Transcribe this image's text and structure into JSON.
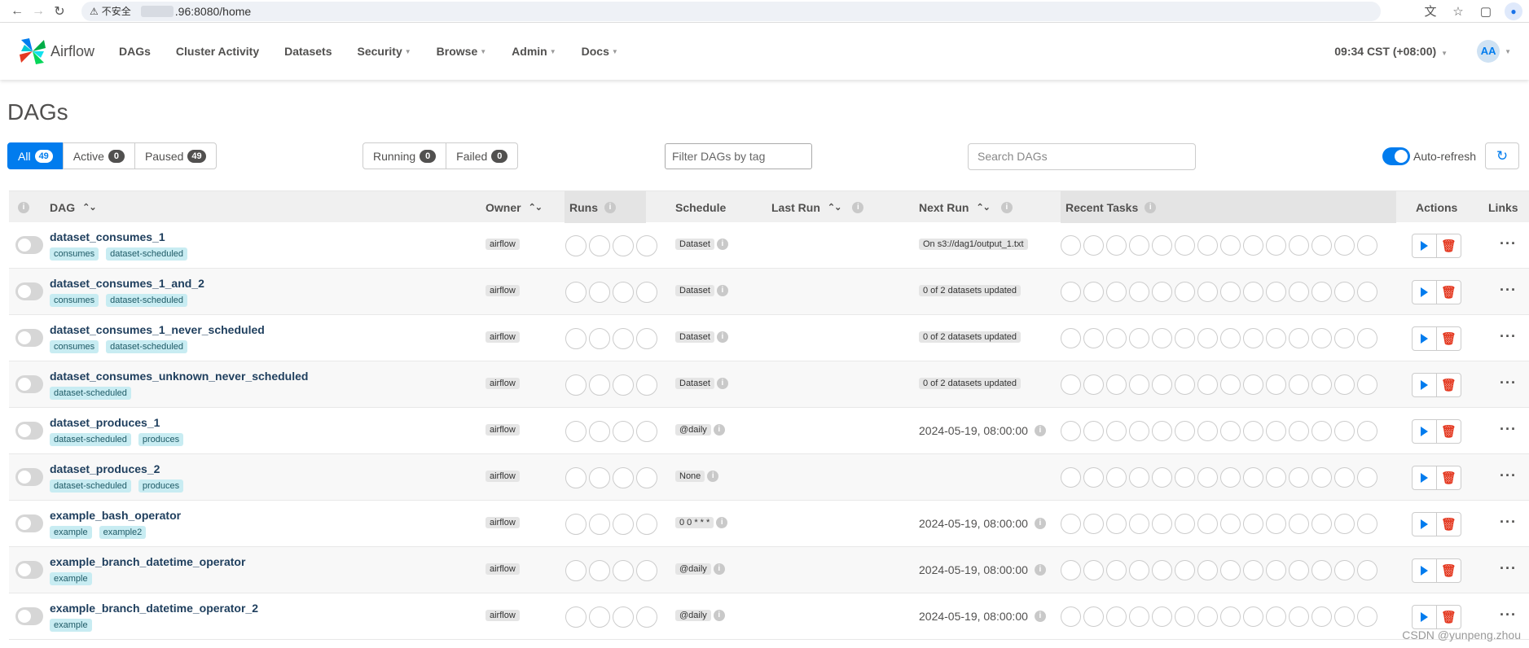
{
  "browser": {
    "url_insecure_label": "不安全",
    "url_text": ".96:8080/home"
  },
  "navbar": {
    "brand": "Airflow",
    "items": [
      {
        "label": "DAGs",
        "dropdown": false
      },
      {
        "label": "Cluster Activity",
        "dropdown": false
      },
      {
        "label": "Datasets",
        "dropdown": false
      },
      {
        "label": "Security",
        "dropdown": true
      },
      {
        "label": "Browse",
        "dropdown": true
      },
      {
        "label": "Admin",
        "dropdown": true
      },
      {
        "label": "Docs",
        "dropdown": true
      }
    ],
    "clock": "09:34 CST (+08:00)",
    "avatar": "AA"
  },
  "page_title": "DAGs",
  "status_filters": {
    "all": {
      "label": "All",
      "count": "49"
    },
    "active": {
      "label": "Active",
      "count": "0"
    },
    "paused": {
      "label": "Paused",
      "count": "49"
    }
  },
  "run_filters": {
    "running": {
      "label": "Running",
      "count": "0"
    },
    "failed": {
      "label": "Failed",
      "count": "0"
    }
  },
  "tag_filter_placeholder": "Filter DAGs by tag",
  "search_placeholder": "Search DAGs",
  "auto_refresh_label": "Auto-refresh",
  "columns": {
    "dag": "DAG",
    "owner": "Owner",
    "runs": "Runs",
    "schedule": "Schedule",
    "last_run": "Last Run",
    "next_run": "Next Run",
    "recent_tasks": "Recent Tasks",
    "actions": "Actions",
    "links": "Links"
  },
  "rows": [
    {
      "name": "dataset_consumes_1",
      "tags": [
        "consumes",
        "dataset-scheduled"
      ],
      "owner": "airflow",
      "schedule": "Dataset",
      "next_run": "On s3://dag1/output_1.txt",
      "next_run_type": "pill"
    },
    {
      "name": "dataset_consumes_1_and_2",
      "tags": [
        "consumes",
        "dataset-scheduled"
      ],
      "owner": "airflow",
      "schedule": "Dataset",
      "next_run": "0 of 2 datasets updated",
      "next_run_type": "pill"
    },
    {
      "name": "dataset_consumes_1_never_scheduled",
      "tags": [
        "consumes",
        "dataset-scheduled"
      ],
      "owner": "airflow",
      "schedule": "Dataset",
      "next_run": "0 of 2 datasets updated",
      "next_run_type": "pill"
    },
    {
      "name": "dataset_consumes_unknown_never_scheduled",
      "tags": [
        "dataset-scheduled"
      ],
      "owner": "airflow",
      "schedule": "Dataset",
      "next_run": "0 of 2 datasets updated",
      "next_run_type": "pill"
    },
    {
      "name": "dataset_produces_1",
      "tags": [
        "dataset-scheduled",
        "produces"
      ],
      "owner": "airflow",
      "schedule": "@daily",
      "next_run": "2024-05-19, 08:00:00",
      "next_run_type": "text"
    },
    {
      "name": "dataset_produces_2",
      "tags": [
        "dataset-scheduled",
        "produces"
      ],
      "owner": "airflow",
      "schedule": "None",
      "next_run": "",
      "next_run_type": "none"
    },
    {
      "name": "example_bash_operator",
      "tags": [
        "example",
        "example2"
      ],
      "owner": "airflow",
      "schedule": "0 0 * * *",
      "next_run": "2024-05-19, 08:00:00",
      "next_run_type": "text"
    },
    {
      "name": "example_branch_datetime_operator",
      "tags": [
        "example"
      ],
      "owner": "airflow",
      "schedule": "@daily",
      "next_run": "2024-05-19, 08:00:00",
      "next_run_type": "text"
    },
    {
      "name": "example_branch_datetime_operator_2",
      "tags": [
        "example"
      ],
      "owner": "airflow",
      "schedule": "@daily",
      "next_run": "2024-05-19, 08:00:00",
      "next_run_type": "text"
    }
  ],
  "watermark": "CSDN @yunpeng.zhou"
}
